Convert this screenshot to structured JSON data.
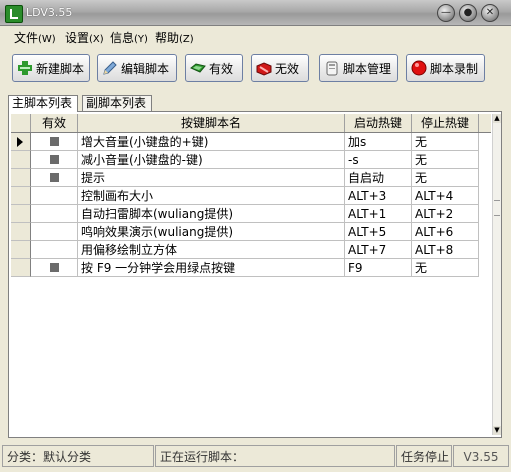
{
  "window": {
    "title": "LDV3.55"
  },
  "menu": [
    {
      "label": "文件",
      "accel": "(W)"
    },
    {
      "label": "设置",
      "accel": "(X)"
    },
    {
      "label": "信息",
      "accel": "(Y)"
    },
    {
      "label": "帮助",
      "accel": "(Z)"
    }
  ],
  "toolbar": {
    "new_script": "新建脚本",
    "edit_script": "编辑脚本",
    "enable": "有效",
    "disable": "无效",
    "manage": "脚本管理",
    "record": "脚本录制"
  },
  "tabs": {
    "main": "主脚本列表",
    "sub": "副脚本列表"
  },
  "grid": {
    "headers": {
      "valid": "有效",
      "name": "按键脚本名",
      "start": "启动热键",
      "stop": "停止热键"
    },
    "rows": [
      {
        "valid": true,
        "name": "增大音量(小键盘的+键)",
        "start": "加s",
        "stop": "无"
      },
      {
        "valid": true,
        "name": "减小音量(小键盘的-键)",
        "start": "-s",
        "stop": "无"
      },
      {
        "valid": true,
        "name": "提示",
        "start": "自启动",
        "stop": "无"
      },
      {
        "valid": false,
        "name": "控制画布大小",
        "start": "ALT+3",
        "stop": "ALT+4"
      },
      {
        "valid": false,
        "name": "自动扫雷脚本(wuliang提供)",
        "start": "ALT+1",
        "stop": "ALT+2"
      },
      {
        "valid": false,
        "name": "鸣响效果演示(wuliang提供)",
        "start": "ALT+5",
        "stop": "ALT+6"
      },
      {
        "valid": false,
        "name": "用偏移绘制立方体",
        "start": "ALT+7",
        "stop": "ALT+8"
      },
      {
        "valid": true,
        "name": "按 F9 一分钟学会用绿点按键",
        "start": "F9",
        "stop": "无"
      }
    ]
  },
  "status": {
    "category": "分类：默认分类",
    "running": "正在运行脚本：",
    "task": "任务停止",
    "version": "V3.55"
  },
  "icons": [
    "app-icon",
    "minimize-icon",
    "maximize-icon",
    "close-icon",
    "plus-icon",
    "pencil-icon",
    "check-icon",
    "cross-icon",
    "manage-icon",
    "record-icon"
  ],
  "colors": {
    "record": "#e01010",
    "enable": "#2e9a2e",
    "disable": "#d01818"
  }
}
